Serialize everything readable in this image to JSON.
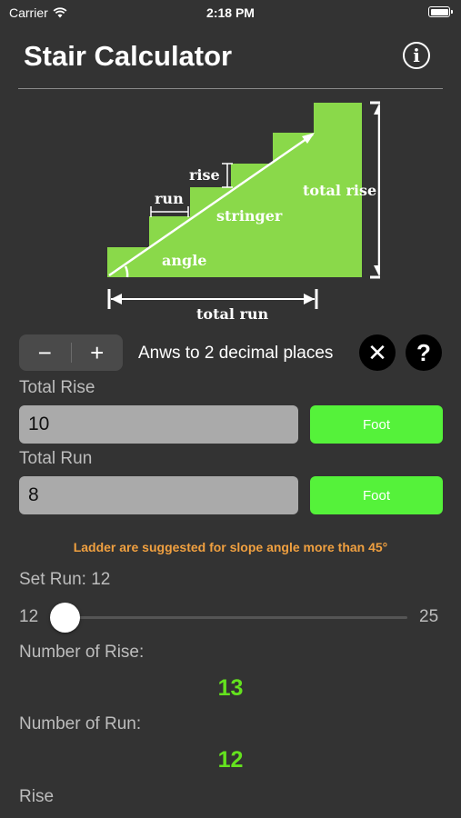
{
  "status_bar": {
    "carrier": "Carrier",
    "time": "2:18 PM"
  },
  "header": {
    "title": "Stair Calculator",
    "info_icon": "info-icon"
  },
  "diagram": {
    "labels": {
      "rise": "rise",
      "run": "run",
      "stringer": "stringer",
      "total_rise": "total rise",
      "angle": "angle",
      "total_run": "total run"
    },
    "colors": {
      "fill": "#8ad94a",
      "lines": "#ffffff"
    }
  },
  "precision": {
    "decrease_label": "−",
    "increase_label": "+",
    "text": "Anws to 2 decimal places",
    "clear_label": "✕",
    "help_label": "?"
  },
  "inputs": {
    "total_rise": {
      "label": "Total Rise",
      "value": "10",
      "unit": "Foot"
    },
    "total_run": {
      "label": "Total Run",
      "value": "8",
      "unit": "Foot"
    }
  },
  "warning": "Ladder are suggested for slope angle more than 45°",
  "run_slider": {
    "label": "Set Run: 12",
    "min": "12",
    "max": "25",
    "value_fraction": 0.0
  },
  "results": {
    "number_of_rise_label": "Number of Rise:",
    "number_of_rise": "13",
    "number_of_run_label": "Number of Run:",
    "number_of_run": "12",
    "rise_label": "Rise"
  },
  "colors": {
    "background": "#333333",
    "accent_green": "#55f23a",
    "result_green": "#64e21e",
    "warning": "#f0a040"
  }
}
